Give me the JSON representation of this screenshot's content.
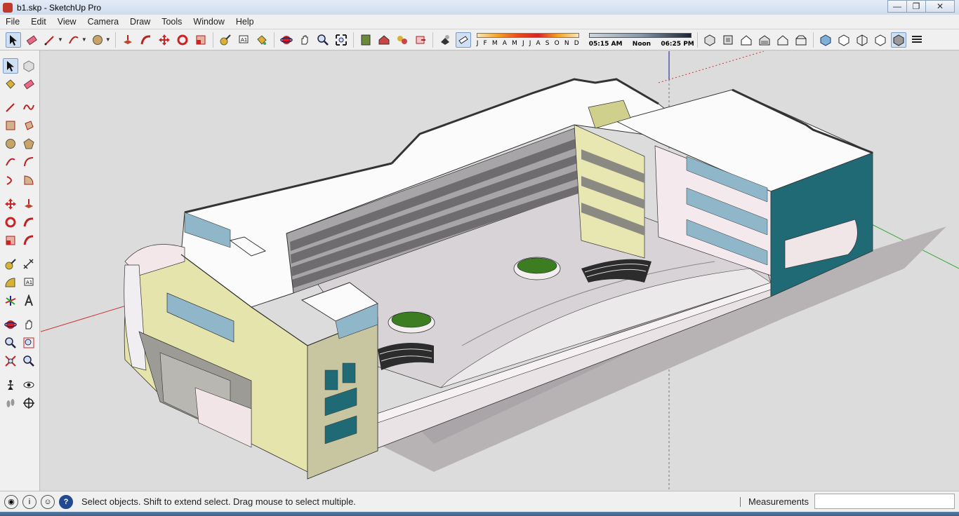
{
  "window": {
    "title": "b1.skp - SketchUp Pro",
    "controls": {
      "minimize": "—",
      "restore": "❐",
      "close": "✕"
    }
  },
  "menu": [
    "File",
    "Edit",
    "View",
    "Camera",
    "Draw",
    "Tools",
    "Window",
    "Help"
  ],
  "shadow": {
    "months": [
      "J",
      "F",
      "M",
      "A",
      "M",
      "J",
      "J",
      "A",
      "S",
      "O",
      "N",
      "D"
    ],
    "time_start": "05:15 AM",
    "time_mid": "Noon",
    "time_end": "06:25 PM"
  },
  "status": {
    "message": "Select objects. Shift to extend select. Drag mouse to select multiple.",
    "measurements_label": "Measurements",
    "measurements_value": "",
    "help_icon": "?"
  },
  "colors": {
    "accent_teal": "#1f6a75",
    "wall_yellow": "#e6e4ad",
    "roof_white": "#fbfbfb",
    "glass_blue": "#8fb7c9",
    "lawn_green": "#3b7d20"
  }
}
